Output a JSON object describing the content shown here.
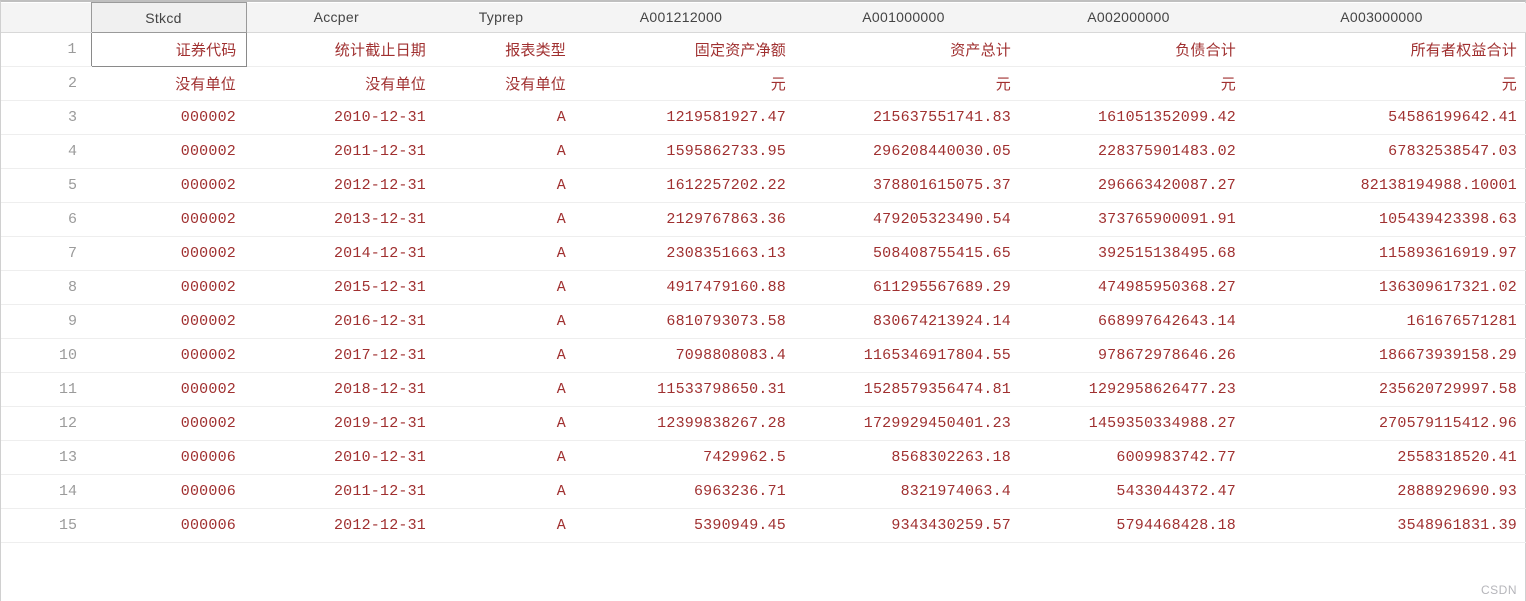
{
  "columns": [
    {
      "key": "Stkcd",
      "label": "Stkcd"
    },
    {
      "key": "Accper",
      "label": "Accper"
    },
    {
      "key": "Typrep",
      "label": "Typrep"
    },
    {
      "key": "A001212000",
      "label": "A001212000"
    },
    {
      "key": "A001000000",
      "label": "A001000000"
    },
    {
      "key": "A002000000",
      "label": "A002000000"
    },
    {
      "key": "A003000000",
      "label": "A003000000"
    }
  ],
  "selected": {
    "row": 1,
    "col": "Stkcd"
  },
  "rows": [
    {
      "n": 1,
      "Stkcd": "证券代码",
      "Accper": "统计截止日期",
      "Typrep": "报表类型",
      "A001212000": "固定资产净额",
      "A001000000": "资产总计",
      "A002000000": "负债合计",
      "A003000000": "所有者权益合计"
    },
    {
      "n": 2,
      "Stkcd": "没有单位",
      "Accper": "没有单位",
      "Typrep": "没有单位",
      "A001212000": "元",
      "A001000000": "元",
      "A002000000": "元",
      "A003000000": "元"
    },
    {
      "n": 3,
      "Stkcd": "000002",
      "Accper": "2010-12-31",
      "Typrep": "A",
      "A001212000": "1219581927.47",
      "A001000000": "215637551741.83",
      "A002000000": "161051352099.42",
      "A003000000": "54586199642.41"
    },
    {
      "n": 4,
      "Stkcd": "000002",
      "Accper": "2011-12-31",
      "Typrep": "A",
      "A001212000": "1595862733.95",
      "A001000000": "296208440030.05",
      "A002000000": "228375901483.02",
      "A003000000": "67832538547.03"
    },
    {
      "n": 5,
      "Stkcd": "000002",
      "Accper": "2012-12-31",
      "Typrep": "A",
      "A001212000": "1612257202.22",
      "A001000000": "378801615075.37",
      "A002000000": "296663420087.27",
      "A003000000": "82138194988.10001"
    },
    {
      "n": 6,
      "Stkcd": "000002",
      "Accper": "2013-12-31",
      "Typrep": "A",
      "A001212000": "2129767863.36",
      "A001000000": "479205323490.54",
      "A002000000": "373765900091.91",
      "A003000000": "105439423398.63"
    },
    {
      "n": 7,
      "Stkcd": "000002",
      "Accper": "2014-12-31",
      "Typrep": "A",
      "A001212000": "2308351663.13",
      "A001000000": "508408755415.65",
      "A002000000": "392515138495.68",
      "A003000000": "115893616919.97"
    },
    {
      "n": 8,
      "Stkcd": "000002",
      "Accper": "2015-12-31",
      "Typrep": "A",
      "A001212000": "4917479160.88",
      "A001000000": "611295567689.29",
      "A002000000": "474985950368.27",
      "A003000000": "136309617321.02"
    },
    {
      "n": 9,
      "Stkcd": "000002",
      "Accper": "2016-12-31",
      "Typrep": "A",
      "A001212000": "6810793073.58",
      "A001000000": "830674213924.14",
      "A002000000": "668997642643.14",
      "A003000000": "161676571281"
    },
    {
      "n": 10,
      "Stkcd": "000002",
      "Accper": "2017-12-31",
      "Typrep": "A",
      "A001212000": "7098808083.4",
      "A001000000": "1165346917804.55",
      "A002000000": "978672978646.26",
      "A003000000": "186673939158.29"
    },
    {
      "n": 11,
      "Stkcd": "000002",
      "Accper": "2018-12-31",
      "Typrep": "A",
      "A001212000": "11533798650.31",
      "A001000000": "1528579356474.81",
      "A002000000": "1292958626477.23",
      "A003000000": "235620729997.58"
    },
    {
      "n": 12,
      "Stkcd": "000002",
      "Accper": "2019-12-31",
      "Typrep": "A",
      "A001212000": "12399838267.28",
      "A001000000": "1729929450401.23",
      "A002000000": "1459350334988.27",
      "A003000000": "270579115412.96"
    },
    {
      "n": 13,
      "Stkcd": "000006",
      "Accper": "2010-12-31",
      "Typrep": "A",
      "A001212000": "7429962.5",
      "A001000000": "8568302263.18",
      "A002000000": "6009983742.77",
      "A003000000": "2558318520.41"
    },
    {
      "n": 14,
      "Stkcd": "000006",
      "Accper": "2011-12-31",
      "Typrep": "A",
      "A001212000": "6963236.71",
      "A001000000": "8321974063.4",
      "A002000000": "5433044372.47",
      "A003000000": "2888929690.93"
    },
    {
      "n": 15,
      "Stkcd": "000006",
      "Accper": "2012-12-31",
      "Typrep": "A",
      "A001212000": "5390949.45",
      "A001000000": "9343430259.57",
      "A002000000": "5794468428.18",
      "A003000000": "3548961831.39"
    }
  ],
  "watermark": "CSDN"
}
